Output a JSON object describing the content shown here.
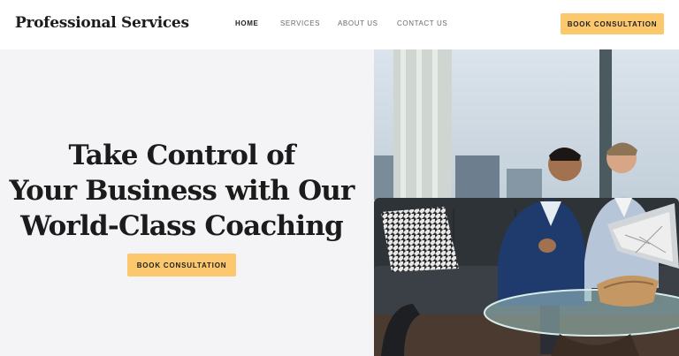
{
  "brand": {
    "name": "Professional Services"
  },
  "nav": {
    "items": [
      {
        "label": "HOME",
        "active": true
      },
      {
        "label": "SERVICES",
        "active": false
      },
      {
        "label": "ABOUT US",
        "active": false
      },
      {
        "label": "CONTACT US",
        "active": false
      }
    ]
  },
  "header": {
    "cta_label": "BOOK CONSULTATION"
  },
  "hero": {
    "title_lines": [
      "Take Control of",
      "Your Business with Our",
      "World-Class Coaching"
    ],
    "cta_label": "BOOK CONSULTATION",
    "image_subject": "two businessmen on a leather sofa reviewing a laptop in a glass-walled office"
  },
  "colors": {
    "accent": "#fbc86e",
    "text_dark": "#1b1b1b",
    "nav_text": "#6a6a6a",
    "hero_background": "#f4f4f6",
    "header_background": "#ffffff"
  }
}
